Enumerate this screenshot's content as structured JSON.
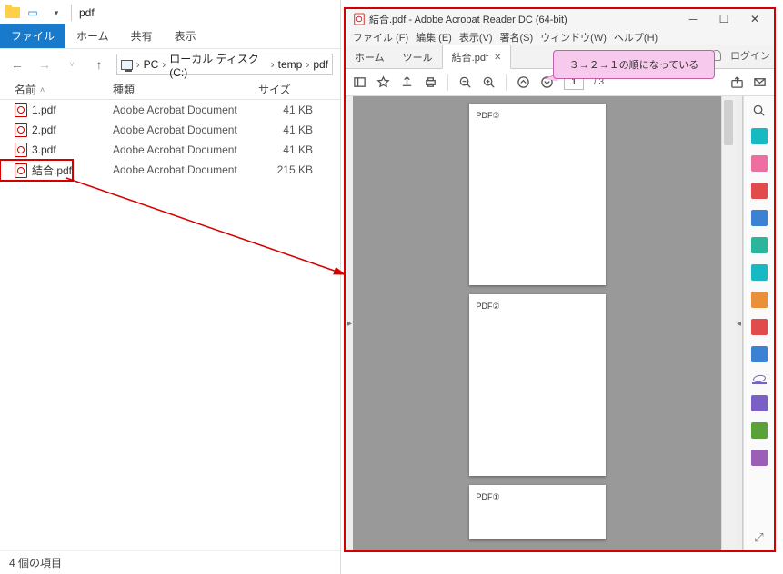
{
  "explorer": {
    "title": "pdf",
    "tabs": {
      "file": "ファイル",
      "home": "ホーム",
      "share": "共有",
      "view": "表示"
    },
    "breadcrumb": [
      "PC",
      "ローカル ディスク (C:)",
      "temp",
      "pdf"
    ],
    "columns": {
      "name": "名前",
      "type": "種類",
      "size": "サイズ"
    },
    "files": [
      {
        "name": "1.pdf",
        "type": "Adobe Acrobat Document",
        "size": "41 KB"
      },
      {
        "name": "2.pdf",
        "type": "Adobe Acrobat Document",
        "size": "41 KB"
      },
      {
        "name": "3.pdf",
        "type": "Adobe Acrobat Document",
        "size": "41 KB"
      },
      {
        "name": "結合.pdf",
        "type": "Adobe Acrobat Document",
        "size": "215 KB"
      }
    ],
    "status": "4 個の項目"
  },
  "acrobat": {
    "title": "結合.pdf - Adobe Acrobat Reader DC (64-bit)",
    "menu": [
      "ファイル (F)",
      "編集 (E)",
      "表示(V)",
      "署名(S)",
      "ウィンドウ(W)",
      "ヘルプ(H)"
    ],
    "tabs": {
      "home": "ホーム",
      "tools": "ツール",
      "doc": "結合.pdf"
    },
    "login": "ログイン",
    "page": {
      "current": "1",
      "total": "/ 3"
    },
    "pages": [
      "PDF③",
      "PDF②",
      "PDF①"
    ]
  },
  "callout": "３→２→１の順になっている"
}
